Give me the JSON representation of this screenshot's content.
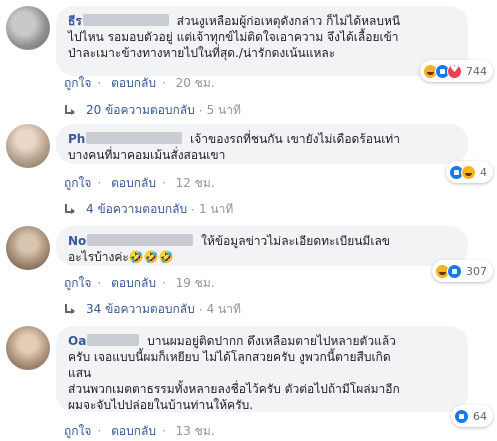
{
  "actions": {
    "like": "ถูกใจ",
    "reply": "ตอบกลับ"
  },
  "comments": [
    {
      "author": "ธีร",
      "line1": "ส่วนงูเหลือมผู้ก่อเหตุดังกล่าว ก็ไม่ได้หลบหนี",
      "line2": "ไปไหน รอมอบตัวอยู่ แต่เจ้าทุกข์ไม่ติดใจเอาความ จึงได้เลื้อยเข้า",
      "line3": "ป่าละเมาะข้างทางหายไปในที่สุด./น่ารักดงเน้นแหละ",
      "reactions": [
        "haha",
        "like",
        "love"
      ],
      "reaction_count": "744",
      "time": "20 ชม.",
      "replies_label": "20 ข้อความตอบกลับ",
      "replies_time": "5 นาที"
    },
    {
      "author": "Ph",
      "line1": "เจ้าของรถที่ชนกัน เขายังไม่เดือดร้อนเท่า",
      "line2": "บางคนที่มาคอมเม้นสั่งสอนเขา",
      "reactions": [
        "like",
        "haha"
      ],
      "reaction_count": "4",
      "time": "12 ชม.",
      "replies_label": "4 ข้อความตอบกลับ",
      "replies_time": "1 นาที"
    },
    {
      "author": "No",
      "line1": "ให้ข้อมูลข่าวไม่ละเอียดทะเบียนมีเลข",
      "line2": "อะไรบ้างค่ะ🤣🤣🤣",
      "reactions": [
        "haha",
        "like"
      ],
      "reaction_count": "307",
      "time": "19 ชม.",
      "replies_label": "34 ข้อความตอบกลับ",
      "replies_time": "4 นาที"
    },
    {
      "author": "Oa",
      "line1": "บานผมอยู่ติดปากก ดึงเหลือมตายไปหลายตัวแล้ว",
      "line2": "ครับ เจอแบบนี้ผมก็เหยียบ ไม่ได้โลกสวยครับ งูพวกนี้ตายสืบเกิด",
      "line3": "แสน",
      "line4": "ส่วนพวกเมตตาธรรมทั้งหลายลงชื่อไว้ครับ ตัวต่อไปถ้ามีโผล่มาอีก",
      "line5": "ผมจะจับไปปล่อยในบ้านท่านให้ครับ.",
      "reactions": [
        "like"
      ],
      "reaction_count": "64",
      "time": "13 ชม."
    }
  ]
}
